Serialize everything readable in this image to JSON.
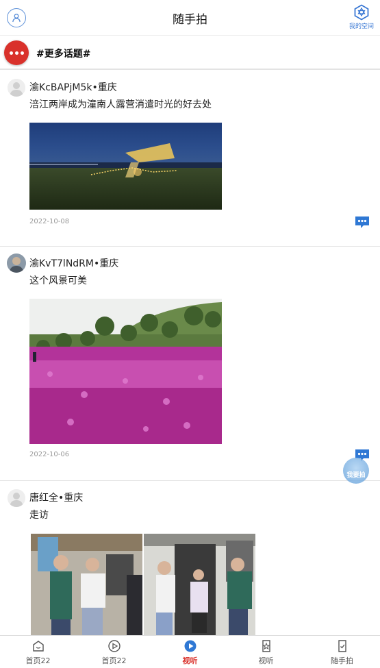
{
  "header": {
    "title": "随手拍",
    "my_space_label": "我的空间"
  },
  "topic_bar": {
    "label": "#更多话题#"
  },
  "posts": [
    {
      "user": "渝KcBAPjM5k•重庆",
      "text": "涪江两岸成为潼南人露营消遣时光的好去处",
      "date": "2022-10-08"
    },
    {
      "user": "渝KvT7lNdRM•重庆",
      "text": "这个风景可美",
      "date": "2022-10-06"
    },
    {
      "user": "唐红全•重庆",
      "text": "走访",
      "date": ""
    }
  ],
  "fab": {
    "label": "我要拍"
  },
  "bottom_nav": [
    {
      "label": "首页22",
      "icon": "home-icon"
    },
    {
      "label": "首页22",
      "icon": "play-circle-icon"
    },
    {
      "label": "视听",
      "icon": "play-circle-filled-icon"
    },
    {
      "label": "视听",
      "icon": "star-document-icon"
    },
    {
      "label": "随手拍",
      "icon": "checkmark-document-icon"
    }
  ],
  "colors": {
    "accent_red": "#d9312b",
    "accent_blue": "#3a78d4"
  }
}
